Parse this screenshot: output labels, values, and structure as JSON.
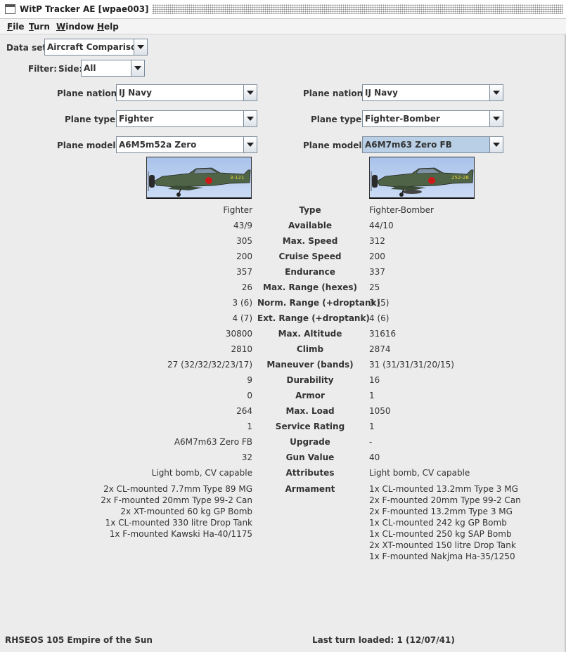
{
  "window": {
    "title": "WitP Tracker AE [wpae003]"
  },
  "menu": [
    {
      "mnemonic": "F",
      "rest": "ile"
    },
    {
      "mnemonic": "T",
      "rest": "urn"
    },
    {
      "mnemonic": "W",
      "rest": "indow"
    },
    {
      "mnemonic": "H",
      "rest": "elp"
    }
  ],
  "dataset": {
    "label": "Data set:",
    "value": "Aircraft Comparison"
  },
  "filter": {
    "label": "Filter:",
    "side_label": "Side:",
    "side_value": "All"
  },
  "left": {
    "nation_label": "Plane nation:",
    "nation": "IJ Navy",
    "type_label": "Plane type:",
    "type": "Fighter",
    "model_label": "Plane model:",
    "model": "A6M5m52a Zero"
  },
  "right": {
    "nation_label": "Plane nation:",
    "nation": "IJ Navy",
    "type_label": "Plane type:",
    "type": "Fighter-Bomber",
    "model_label": "Plane model:",
    "model": "A6M7m63 Zero FB"
  },
  "left_plane_marking": "3-121",
  "right_plane_marking": "252-28",
  "colors": {
    "window_bg": "#ececec",
    "selection": "#b8cfe5",
    "sky": "#b9cff0",
    "zero_green": "#4f6447",
    "hinomaru": "#cc1a1a"
  },
  "stats": [
    {
      "left": "Fighter",
      "label": "Type",
      "right": "Fighter-Bomber"
    },
    {
      "left": "43/9",
      "label": "Available",
      "right": "44/10"
    },
    {
      "left": "305",
      "label": "Max. Speed",
      "right": "312"
    },
    {
      "left": "200",
      "label": "Cruise Speed",
      "right": "200"
    },
    {
      "left": "357",
      "label": "Endurance",
      "right": "337"
    },
    {
      "left": "26",
      "label": "Max. Range (hexes)",
      "right": "25"
    },
    {
      "left": "3 (6)",
      "label": "Norm. Range (+droptank)",
      "right": "3 (5)"
    },
    {
      "left": "4 (7)",
      "label": "Ext. Range (+droptank)",
      "right": "4 (6)"
    },
    {
      "left": "30800",
      "label": "Max. Altitude",
      "right": "31616"
    },
    {
      "left": "2810",
      "label": "Climb",
      "right": "2874"
    },
    {
      "left": "27 (32/32/32/23/17)",
      "label": "Maneuver (bands)",
      "right": "31 (31/31/31/20/15)"
    },
    {
      "left": "9",
      "label": "Durability",
      "right": "16"
    },
    {
      "left": "0",
      "label": "Armor",
      "right": "1"
    },
    {
      "left": "264",
      "label": "Max. Load",
      "right": "1050"
    },
    {
      "left": "1",
      "label": "Service Rating",
      "right": "1"
    },
    {
      "left": "A6M7m63 Zero FB",
      "label": "Upgrade",
      "right": "-"
    },
    {
      "left": "32",
      "label": "Gun Value",
      "right": "40"
    },
    {
      "left": "Light bomb, CV capable",
      "label": "Attributes",
      "right": "Light bomb, CV capable"
    }
  ],
  "armament": {
    "label": "Armament",
    "left": [
      "2x CL-mounted 7.7mm Type 89 MG",
      "2x F-mounted 20mm Type 99-2 Can",
      "2x XT-mounted 60 kg GP Bomb",
      "1x CL-mounted 330 litre Drop Tank",
      "1x F-mounted Kawski Ha-40/1175"
    ],
    "right": [
      "1x CL-mounted 13.2mm Type 3 MG",
      "2x F-mounted 20mm Type 99-2 Can",
      "2x F-mounted 13.2mm Type 3 MG",
      "1x CL-mounted 242 kg GP Bomb",
      "1x CL-mounted 250 kg SAP Bomb",
      "2x XT-mounted 150 litre Drop Tank",
      "1x F-mounted Nakjma Ha-35/1250"
    ]
  },
  "status": {
    "scenario": "RHSEOS 105 Empire of the Sun",
    "last_turn": "Last turn loaded: 1 (12/07/41)"
  }
}
